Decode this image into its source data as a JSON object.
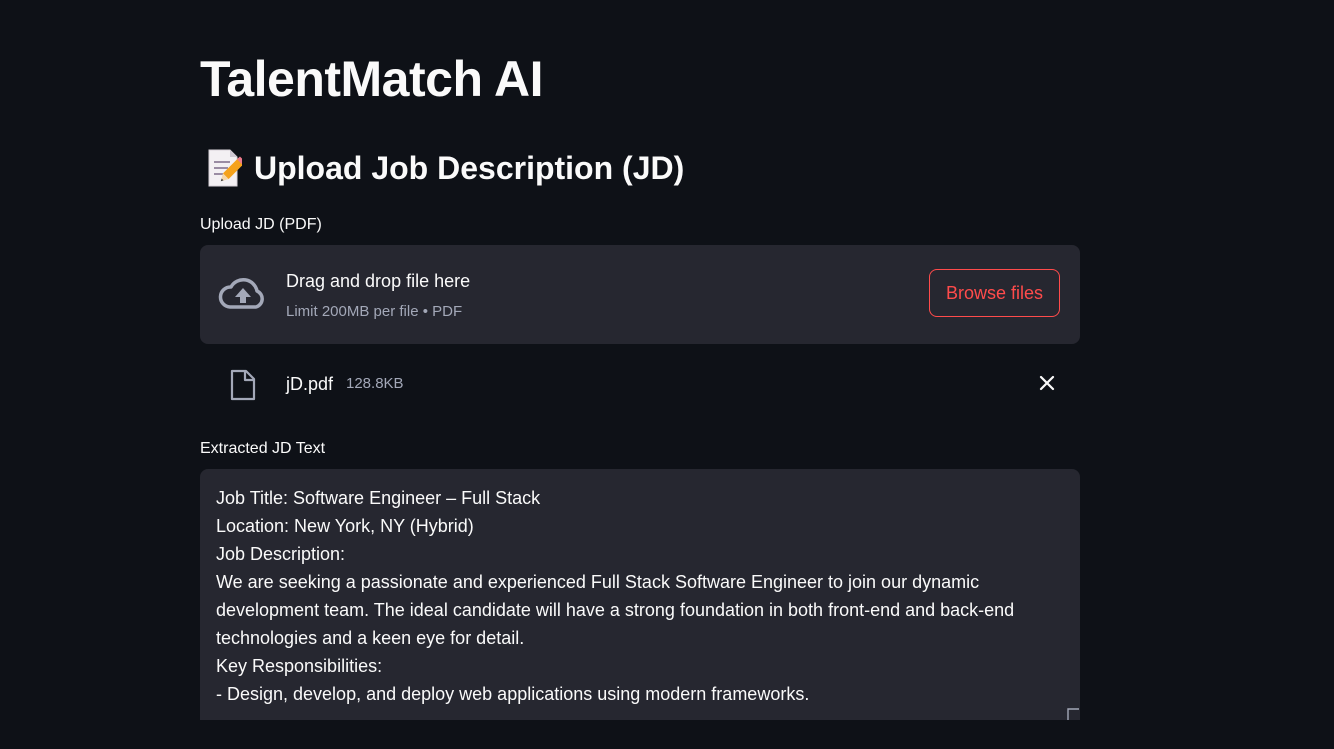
{
  "app": {
    "title": "TalentMatch AI"
  },
  "upload_section": {
    "icon": "memo-icon",
    "title": "Upload Job Description (JD)",
    "uploader_label": "Upload JD (PDF)",
    "dropzone": {
      "icon": "cloud-upload-icon",
      "main_text": "Drag and drop file here",
      "sub_text": "Limit 200MB per file • PDF",
      "browse_label": "Browse files"
    },
    "uploaded_file": {
      "icon": "file-icon",
      "name": "jD.pdf",
      "size": "128.8KB",
      "remove_icon": "close-icon"
    }
  },
  "extracted": {
    "label": "Extracted JD Text",
    "text": "Job Title: Software Engineer – Full Stack\nLocation: New York, NY (Hybrid)\nJob Description:\nWe are seeking a passionate and experienced Full Stack Software Engineer to join our dynamic\ndevelopment team. The ideal candidate will have a strong foundation in both front-end and back-end\ntechnologies and a keen eye for detail.\nKey Responsibilities:\n- Design, develop, and deploy web applications using modern frameworks."
  },
  "colors": {
    "background": "#0e1117",
    "panel": "#262730",
    "accent": "#ff4b4b",
    "text": "#fafafa",
    "muted_text": "#a3a8b8"
  }
}
